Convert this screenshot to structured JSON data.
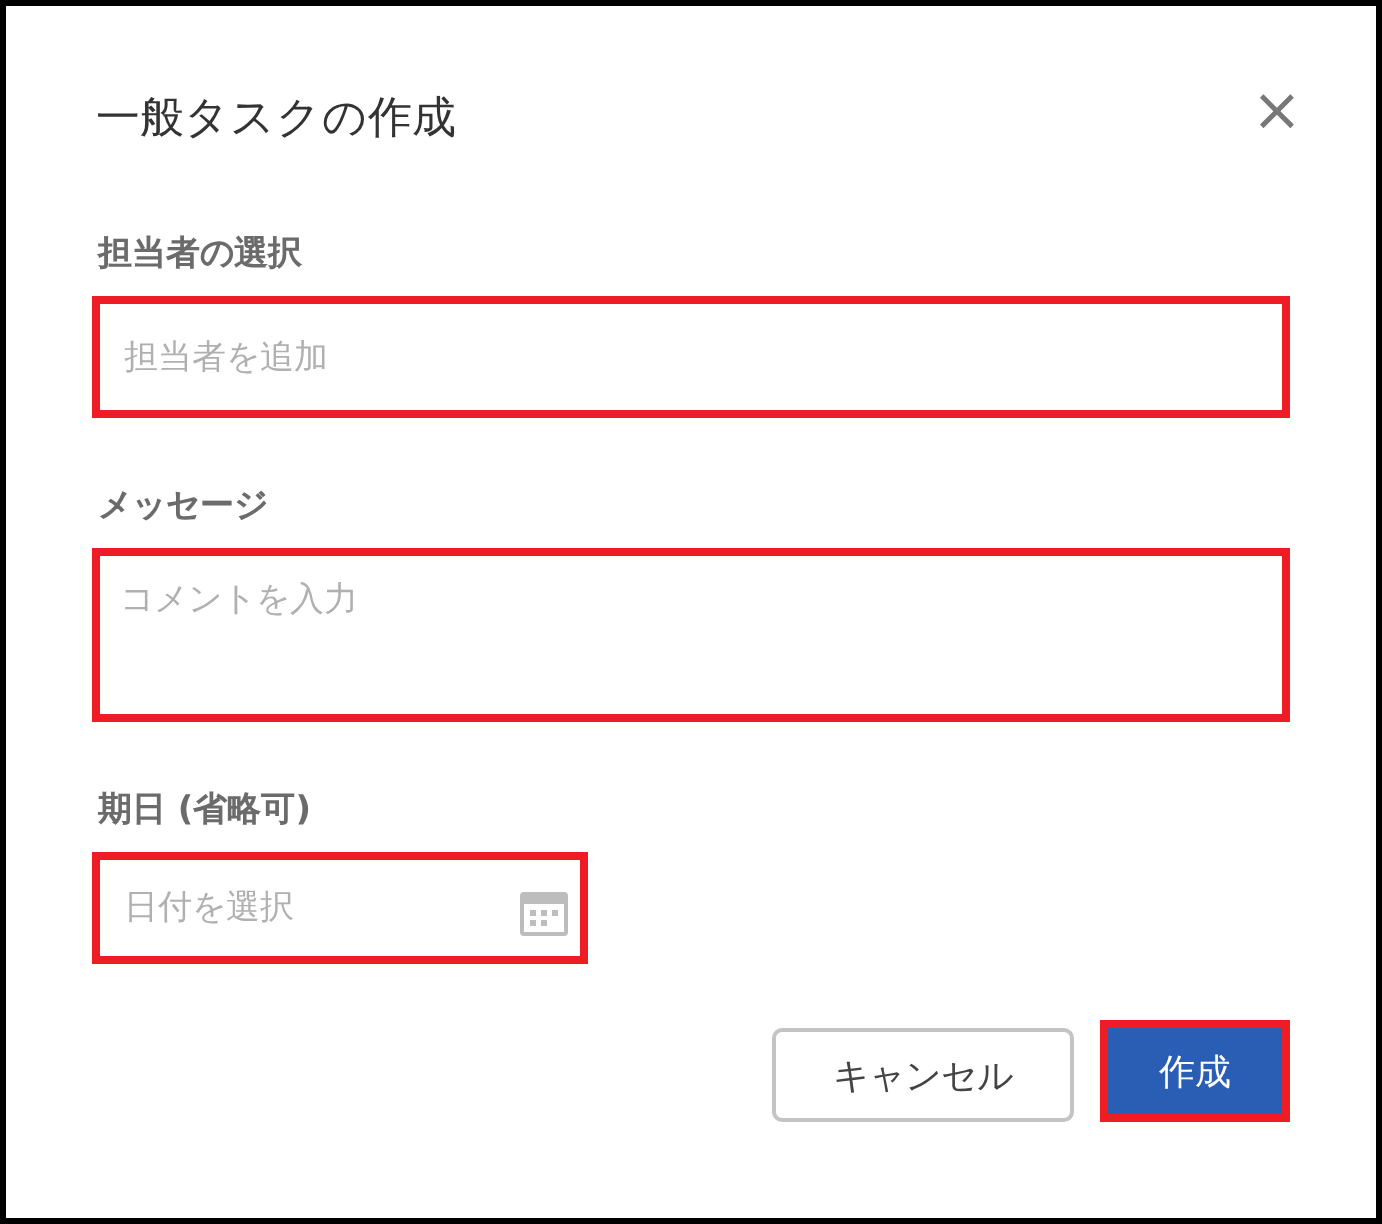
{
  "dialog": {
    "title": "一般タスクの作成",
    "close": "×"
  },
  "fields": [
    {
      "kind": "text",
      "label": "担当者の選択",
      "placeholder": "担当者を追加",
      "highlighted": true
    },
    {
      "kind": "textarea",
      "label": "メッセージ",
      "placeholder": "コメントを入力",
      "highlighted": true
    },
    {
      "kind": "date",
      "label": "期日 (省略可)",
      "placeholder": "日付を選択",
      "highlighted": true
    }
  ],
  "buttons": [
    {
      "label": "キャンセル",
      "kind": "secondary",
      "highlighted": false
    },
    {
      "label": "作成",
      "kind": "primary",
      "highlighted": true
    }
  ]
}
